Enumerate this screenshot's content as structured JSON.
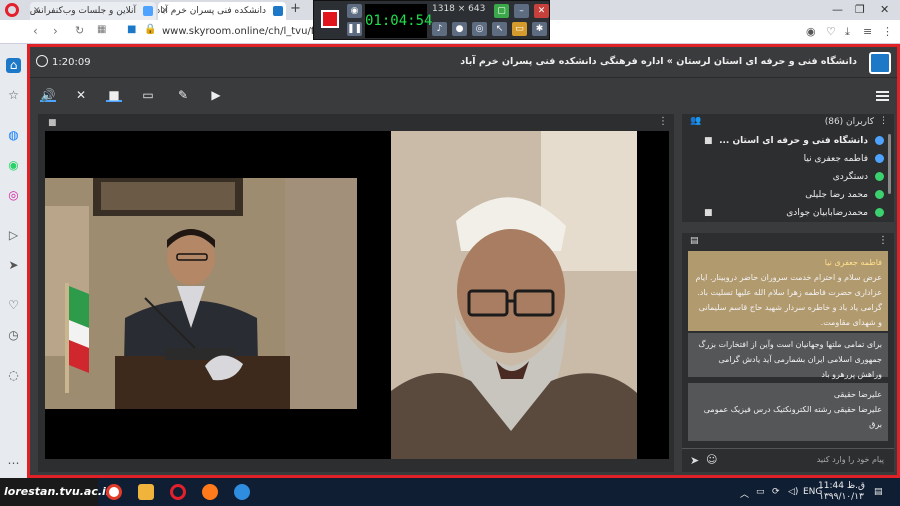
{
  "browser": {
    "tabs": [
      {
        "label": "آنلاین و جلسات وب‌کنفرانس",
        "active": false
      },
      {
        "label": "دانشکده فنی پسران خرم آباد",
        "active": true
      }
    ],
    "new_tab": "+",
    "url": "www.skyroom.online/ch/l_tvu/farhan",
    "window_controls": [
      "—",
      "❐",
      "✕"
    ]
  },
  "recorder": {
    "timer": "01:04:54",
    "resolution": "1318 × 643"
  },
  "skyroom": {
    "title": "دانشگاه فنی و حرفه ای استان لرستان » اداره فرهنگی دانشکده فنی پسران خرم آباد",
    "session_time": "1:20:09",
    "users_header": "کاربران (86)",
    "users": [
      {
        "name": "دانشگاه فنی و حرفه ای استان ...",
        "bold": true,
        "color": "#4da3ff",
        "video": true
      },
      {
        "name": "فاطمه جعفری نیا",
        "bold": false,
        "color": "#4da3ff",
        "video": false
      },
      {
        "name": "دستگردی",
        "bold": false,
        "color": "#3bd16f",
        "video": false
      },
      {
        "name": "محمد رضا جلیلی",
        "bold": false,
        "color": "#3bd16f",
        "video": false
      },
      {
        "name": "محمدرضابابیان جوادی",
        "bold": false,
        "color": "#3bd16f",
        "video": true
      }
    ],
    "chat": {
      "messages": [
        {
          "author": "فاطمه جعفری نیا",
          "text": "عرض سلام و احترام خدمت   سروران حاضر دروبینار. ایام عزاداری حضرت فاطمه زهرا سلام الله علیها تسلیت باد. گرامی یاد باد و خاطره سردار شهید حاج قاسم سلیمانی و شهدای مقاومت.",
          "highlight": true
        },
        {
          "author": "",
          "text": "برای تمامی ملتها وجهانیان است وآین از افتخارات بزرگ جمهوری اسلامی ایران بشمارمی آید یادش گرامی وراهش پررهرو باد",
          "highlight": false
        },
        {
          "author": "علیرضا حقیقی",
          "text": "علیرضا حقیقی رشته الکترونکتیک درس فیزیک عمومی برق",
          "highlight": false
        }
      ],
      "placeholder": "پیام خود را وارد کنید"
    }
  },
  "taskbar": {
    "brand": "lorestan.tvu.ac.ir",
    "language": "ENG",
    "time": "11:44 ق.ظ",
    "date": "۱۳۹۹/۱۰/۱۳"
  }
}
